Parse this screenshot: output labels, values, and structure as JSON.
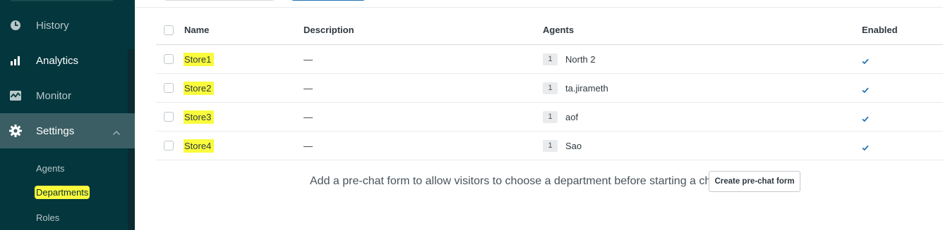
{
  "sidebar": {
    "nav": [
      {
        "label": "History",
        "icon": "clock-icon"
      },
      {
        "label": "Analytics",
        "icon": "bar-chart-icon"
      },
      {
        "label": "Monitor",
        "icon": "pulse-icon"
      },
      {
        "label": "Settings",
        "icon": "gear-icon"
      }
    ],
    "settings_sub": [
      {
        "label": "Agents"
      },
      {
        "label": "Departments"
      },
      {
        "label": "Roles"
      }
    ]
  },
  "table": {
    "headers": {
      "name": "Name",
      "description": "Description",
      "agents": "Agents",
      "enabled": "Enabled"
    },
    "rows": [
      {
        "name": "Store1",
        "description": "—",
        "agent_count": "1",
        "agent": "North 2",
        "enabled": true
      },
      {
        "name": "Store2",
        "description": "—",
        "agent_count": "1",
        "agent": "ta.jirameth",
        "enabled": true
      },
      {
        "name": "Store3",
        "description": "—",
        "agent_count": "1",
        "agent": "aof",
        "enabled": true
      },
      {
        "name": "Store4",
        "description": "—",
        "agent_count": "1",
        "agent": "Sao",
        "enabled": true
      }
    ]
  },
  "prechat": {
    "message": "Add a pre-chat form to allow visitors to choose a department before starting a chat.",
    "button_label": "Create pre-chat form"
  },
  "colors": {
    "sidebar_bg": "#03363d",
    "sidebar_active": "#3a5e63",
    "highlight": "#f9fb3c",
    "check": "#1f73b7"
  }
}
